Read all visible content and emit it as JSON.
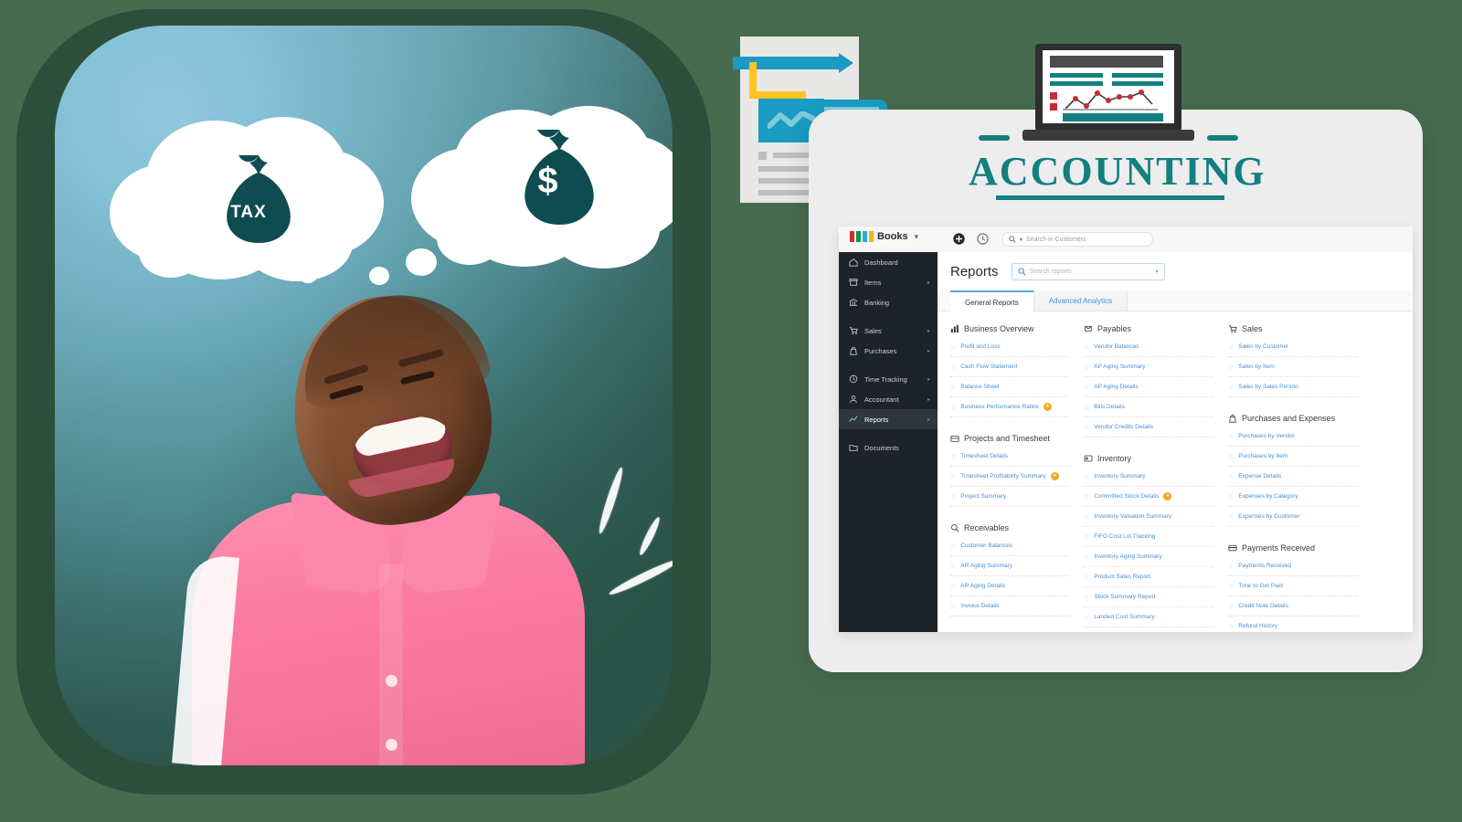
{
  "banner": {
    "accounting_title": "ACCOUNTING",
    "bubbles": [
      {
        "name": "tax-money-bag",
        "label": "TAX"
      },
      {
        "name": "dollar-money-bag",
        "label": "$"
      }
    ],
    "icons": {
      "document": "document-icon",
      "pen": "pen-icon",
      "calculator": "calculator-icon",
      "laptop": "laptop-chart-icon"
    }
  },
  "app": {
    "topbar": {
      "logo_text": "Books",
      "logo_blocks": [
        "#E42527",
        "#089949",
        "#2EA7E0",
        "#F9B21D"
      ],
      "dropdown_icon": "chevron-down-icon",
      "add_icon": "add-circle-icon",
      "history_icon": "clock-history-icon",
      "search_placeholder": "Search in Customers",
      "search_icon": "search-icon",
      "search_dropdown_icon": "caret-down-icon"
    },
    "sidebar": {
      "items": [
        {
          "label": "Dashboard",
          "icon": "dashboard-icon",
          "arrow": false,
          "active": false
        },
        {
          "label": "Items",
          "icon": "items-icon",
          "arrow": true,
          "active": false
        },
        {
          "label": "Banking",
          "icon": "banking-icon",
          "arrow": false,
          "active": false
        },
        {
          "label": "Sales",
          "icon": "sales-cart-icon",
          "arrow": true,
          "active": false,
          "gap_before": true
        },
        {
          "label": "Purchases",
          "icon": "purchases-bag-icon",
          "arrow": true,
          "active": false
        },
        {
          "label": "Time Tracking",
          "icon": "clock-icon",
          "arrow": true,
          "active": false,
          "gap_before": true
        },
        {
          "label": "Accountant",
          "icon": "accountant-icon",
          "arrow": true,
          "active": false
        },
        {
          "label": "Reports",
          "icon": "reports-chart-icon",
          "arrow": true,
          "active": true
        },
        {
          "label": "Documents",
          "icon": "documents-folder-icon",
          "arrow": false,
          "active": false,
          "gap_before": true
        }
      ]
    },
    "page": {
      "title": "Reports",
      "search_placeholder": "Search reports",
      "search_icon": "search-icon",
      "tabs": [
        {
          "label": "General Reports",
          "active": true
        },
        {
          "label": "Advanced Analytics",
          "active": false
        }
      ]
    },
    "columns": [
      {
        "groups": [
          {
            "title": "Business Overview",
            "icon": "bar-chart-icon",
            "reports": [
              {
                "label": "Profit and Loss",
                "badge": false
              },
              {
                "label": "Cash Flow Statement",
                "badge": false
              },
              {
                "label": "Balance Sheet",
                "badge": false
              },
              {
                "label": "Business Performance Ratios",
                "badge": true
              }
            ]
          },
          {
            "title": "Projects and Timesheet",
            "icon": "projects-icon",
            "reports": [
              {
                "label": "Timesheet Details",
                "badge": false
              },
              {
                "label": "Timesheet Profitability Summary",
                "badge": true
              },
              {
                "label": "Project Summary",
                "badge": false
              }
            ]
          },
          {
            "title": "Receivables",
            "icon": "receivables-icon",
            "reports": [
              {
                "label": "Customer Balances",
                "badge": false
              },
              {
                "label": "AR Aging Summary",
                "badge": false
              },
              {
                "label": "AR Aging Details",
                "badge": false
              },
              {
                "label": "Invoice Details",
                "badge": false
              }
            ]
          }
        ]
      },
      {
        "groups": [
          {
            "title": "Payables",
            "icon": "payables-icon",
            "reports": [
              {
                "label": "Vendor Balances",
                "badge": false
              },
              {
                "label": "AP Aging Summary",
                "badge": false
              },
              {
                "label": "AP Aging Details",
                "badge": false
              },
              {
                "label": "Bills Details",
                "badge": false
              },
              {
                "label": "Vendor Credits Details",
                "badge": false
              }
            ]
          },
          {
            "title": "Inventory",
            "icon": "inventory-icon",
            "reports": [
              {
                "label": "Inventory Summary",
                "badge": false
              },
              {
                "label": "Committed Stock Details",
                "badge": true
              },
              {
                "label": "Inventory Valuation Summary",
                "badge": false
              },
              {
                "label": "FIFO Cost Lot Tracking",
                "badge": false
              },
              {
                "label": "Inventory Aging Summary",
                "badge": false
              },
              {
                "label": "Product Sales Report",
                "badge": false
              },
              {
                "label": "Stock Summary Report",
                "badge": false
              },
              {
                "label": "Landed Cost Summary",
                "badge": false
              }
            ]
          }
        ]
      },
      {
        "groups": [
          {
            "title": "Sales",
            "icon": "sales-cart-icon",
            "reports": [
              {
                "label": "Sales by Customer",
                "badge": false
              },
              {
                "label": "Sales by Item",
                "badge": false
              },
              {
                "label": "Sales by Sales Person",
                "badge": false
              }
            ]
          },
          {
            "title": "Purchases and Expenses",
            "icon": "purchases-bag-icon",
            "reports": [
              {
                "label": "Purchases by Vendor",
                "badge": false
              },
              {
                "label": "Purchases by Item",
                "badge": false
              },
              {
                "label": "Expense Details",
                "badge": false
              },
              {
                "label": "Expenses by Category",
                "badge": false
              },
              {
                "label": "Expenses by Customer",
                "badge": false
              }
            ]
          },
          {
            "title": "Payments Received",
            "icon": "payments-card-icon",
            "reports": [
              {
                "label": "Payments Received",
                "badge": false
              },
              {
                "label": "Time to Get Paid",
                "badge": false
              },
              {
                "label": "Credit Note Details",
                "badge": false
              },
              {
                "label": "Refund History",
                "badge": false
              }
            ]
          }
        ]
      }
    ]
  },
  "colors": {
    "teal_accent": "#137F7F",
    "dark_green_bg": "#476B4F",
    "card_border": "#2C4F3B",
    "shirt_pink": "#FB7BA2",
    "money_bag": "#0F4C52",
    "calculator_blue": "#1A9BC4",
    "calculator_key": "#FFC222",
    "link_blue": "#4A8FD0",
    "sidebar_dark": "#1E2328"
  }
}
